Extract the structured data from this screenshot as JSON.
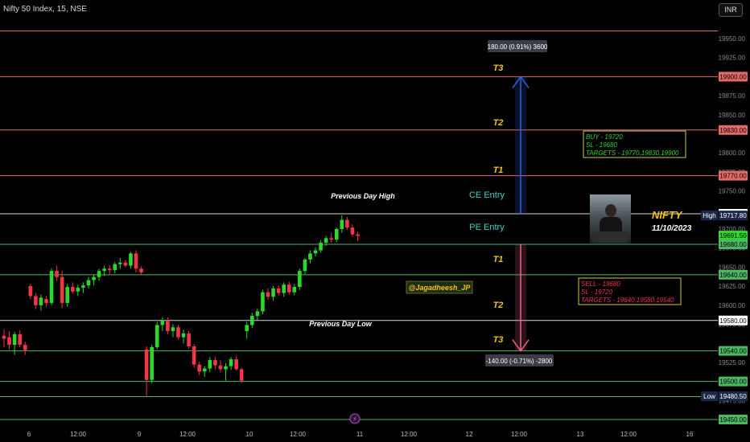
{
  "symbol": "Nifty 50 Index, 15, NSE",
  "currency": "INR",
  "colors": {
    "up": "#089981",
    "up_bright": "#2bd82b",
    "down": "#f23645",
    "red_line": "#e46a6a",
    "green_line": "#4cb863",
    "white_line": "#d8d8d8",
    "gold": "#f0c419",
    "teal": "#3fd1c7",
    "blue_arrow": "#2f5fd8",
    "pink_arrow": "#f0638c"
  },
  "price_scale": {
    "ticks": [
      "19950.00",
      "19925.00",
      "19875.00",
      "19850.00",
      "19800.00",
      "19775.00",
      "19750.00",
      "19700.00",
      "19675.00",
      "19650.00",
      "19625.00",
      "19600.00",
      "19575.00",
      "19525.00",
      "19500.00",
      "19475.00"
    ],
    "badges": [
      {
        "text": "19900.00",
        "color": "#e46a6a",
        "value": 19900
      },
      {
        "text": "19830.00",
        "color": "#e46a6a",
        "value": 19830
      },
      {
        "text": "19770.00",
        "color": "#e46a6a",
        "value": 19770
      },
      {
        "text": "19720.00",
        "color": "#ffffff",
        "value": 19720
      },
      {
        "text": "19717.80",
        "color": "#1b2a4a",
        "value": 19717.8,
        "tag": "High"
      },
      {
        "text": "19691.50",
        "color": "#2bd82b",
        "value": 19691.5
      },
      {
        "text": "19680.00",
        "color": "#4cb863",
        "value": 19680
      },
      {
        "text": "19640.00",
        "color": "#4cb863",
        "value": 19640
      },
      {
        "text": "19580.00",
        "color": "#ffffff",
        "value": 19580
      },
      {
        "text": "19540.00",
        "color": "#4cb863",
        "value": 19540
      },
      {
        "text": "19500.00",
        "color": "#4cb863",
        "value": 19500
      },
      {
        "text": "19480.50",
        "color": "#1b2a4a",
        "value": 19480.5,
        "tag": "Low"
      },
      {
        "text": "19450.00",
        "color": "#4cb863",
        "value": 19450
      }
    ]
  },
  "time_axis": [
    "6",
    "12:00",
    "9",
    "12:00",
    "10",
    "12:00",
    "11",
    "12:00",
    "12",
    "12:00",
    "13",
    "12:00",
    "16"
  ],
  "levels": [
    {
      "value": 19960,
      "color": "#e46a6a"
    },
    {
      "value": 19900,
      "color": "#e46a6a"
    },
    {
      "value": 19830,
      "color": "#e46a6a"
    },
    {
      "value": 19770,
      "color": "#e46a6a"
    },
    {
      "value": 19720,
      "color": "#d8d8d8"
    },
    {
      "value": 19680,
      "color": "#4cb863"
    },
    {
      "value": 19640,
      "color": "#4cb863"
    },
    {
      "value": 19580,
      "color": "#d8d8d8"
    },
    {
      "value": 19540,
      "color": "#4cb863"
    },
    {
      "value": 19500,
      "color": "#4cb863"
    },
    {
      "value": 19480,
      "color": "#4cb863"
    },
    {
      "value": 19450,
      "color": "#4cb863"
    }
  ],
  "labels": {
    "prev_day_high": "Previous Day High",
    "prev_day_low": "Previous Day Low",
    "ce_entry": "CE Entry",
    "pe_entry": "PE Entry",
    "t3_up": "T3",
    "t2_up": "T2",
    "t1_up": "T1",
    "t1_dn": "T1",
    "t2_dn": "T2",
    "t3_dn": "T3",
    "handle": "@Jagadheesh_JP",
    "nifty": "NIFTY",
    "date": "11/10/2023"
  },
  "measure_up": "180.00 (0.91%) 3600",
  "measure_down": "-140.00 (-0.71%) -2800",
  "buy_box": [
    "BUY - 19720",
    "SL - 19680",
    "TARGETS - 19770,19830,19900"
  ],
  "sell_box": [
    "SELL - 19680",
    "SL - 19720",
    "TARGETS - 19640,19580,19540"
  ],
  "chart_data": {
    "type": "candlestick",
    "ylim": [
      19445,
      19975
    ],
    "candles": [
      {
        "o": 19560,
        "h": 19568,
        "l": 19545,
        "c": 19556
      },
      {
        "o": 19558,
        "h": 19566,
        "l": 19542,
        "c": 19548
      },
      {
        "o": 19548,
        "h": 19565,
        "l": 19535,
        "c": 19562
      },
      {
        "o": 19562,
        "h": 19567,
        "l": 19545,
        "c": 19548
      },
      {
        "o": 19548,
        "h": 19552,
        "l": 19535,
        "c": 19541
      },
      {
        "o": 19625,
        "h": 19628,
        "l": 19608,
        "c": 19612
      },
      {
        "o": 19612,
        "h": 19616,
        "l": 19595,
        "c": 19600
      },
      {
        "o": 19600,
        "h": 19614,
        "l": 19593,
        "c": 19610
      },
      {
        "o": 19608,
        "h": 19612,
        "l": 19598,
        "c": 19603
      },
      {
        "o": 19603,
        "h": 19648,
        "l": 19600,
        "c": 19645
      },
      {
        "o": 19645,
        "h": 19652,
        "l": 19632,
        "c": 19637
      },
      {
        "o": 19637,
        "h": 19645,
        "l": 19596,
        "c": 19603
      },
      {
        "o": 19603,
        "h": 19628,
        "l": 19598,
        "c": 19624
      },
      {
        "o": 19624,
        "h": 19630,
        "l": 19615,
        "c": 19618
      },
      {
        "o": 19618,
        "h": 19627,
        "l": 19612,
        "c": 19623
      },
      {
        "o": 19623,
        "h": 19630,
        "l": 19616,
        "c": 19626
      },
      {
        "o": 19626,
        "h": 19637,
        "l": 19622,
        "c": 19633
      },
      {
        "o": 19633,
        "h": 19640,
        "l": 19626,
        "c": 19637
      },
      {
        "o": 19637,
        "h": 19648,
        "l": 19632,
        "c": 19645
      },
      {
        "o": 19645,
        "h": 19652,
        "l": 19638,
        "c": 19648
      },
      {
        "o": 19648,
        "h": 19653,
        "l": 19641,
        "c": 19646
      },
      {
        "o": 19646,
        "h": 19657,
        "l": 19642,
        "c": 19654
      },
      {
        "o": 19654,
        "h": 19662,
        "l": 19648,
        "c": 19656
      },
      {
        "o": 19656,
        "h": 19659,
        "l": 19650,
        "c": 19652
      },
      {
        "o": 19652,
        "h": 19670,
        "l": 19648,
        "c": 19668
      },
      {
        "o": 19668,
        "h": 19672,
        "l": 19643,
        "c": 19648
      },
      {
        "o": 19648,
        "h": 19651,
        "l": 19640,
        "c": 19643
      },
      {
        "o": 19542,
        "h": 19546,
        "l": 19481,
        "c": 19502
      },
      {
        "o": 19502,
        "h": 19548,
        "l": 19498,
        "c": 19545
      },
      {
        "o": 19545,
        "h": 19578,
        "l": 19542,
        "c": 19574
      },
      {
        "o": 19574,
        "h": 19584,
        "l": 19566,
        "c": 19580
      },
      {
        "o": 19580,
        "h": 19584,
        "l": 19562,
        "c": 19566
      },
      {
        "o": 19566,
        "h": 19575,
        "l": 19558,
        "c": 19571
      },
      {
        "o": 19571,
        "h": 19574,
        "l": 19555,
        "c": 19558
      },
      {
        "o": 19558,
        "h": 19568,
        "l": 19550,
        "c": 19563
      },
      {
        "o": 19563,
        "h": 19566,
        "l": 19543,
        "c": 19546
      },
      {
        "o": 19546,
        "h": 19549,
        "l": 19518,
        "c": 19522
      },
      {
        "o": 19522,
        "h": 19526,
        "l": 19508,
        "c": 19513
      },
      {
        "o": 19513,
        "h": 19520,
        "l": 19506,
        "c": 19517
      },
      {
        "o": 19517,
        "h": 19532,
        "l": 19512,
        "c": 19528
      },
      {
        "o": 19528,
        "h": 19532,
        "l": 19516,
        "c": 19521
      },
      {
        "o": 19521,
        "h": 19528,
        "l": 19512,
        "c": 19516
      },
      {
        "o": 19516,
        "h": 19524,
        "l": 19501,
        "c": 19520
      },
      {
        "o": 19520,
        "h": 19532,
        "l": 19515,
        "c": 19529
      },
      {
        "o": 19529,
        "h": 19533,
        "l": 19514,
        "c": 19516
      },
      {
        "o": 19516,
        "h": 19518,
        "l": 19498,
        "c": 19501
      },
      {
        "o": 19566,
        "h": 19578,
        "l": 19556,
        "c": 19574
      },
      {
        "o": 19574,
        "h": 19590,
        "l": 19570,
        "c": 19586
      },
      {
        "o": 19586,
        "h": 19596,
        "l": 19580,
        "c": 19592
      },
      {
        "o": 19592,
        "h": 19620,
        "l": 19588,
        "c": 19617
      },
      {
        "o": 19617,
        "h": 19622,
        "l": 19607,
        "c": 19611
      },
      {
        "o": 19611,
        "h": 19625,
        "l": 19606,
        "c": 19622
      },
      {
        "o": 19622,
        "h": 19626,
        "l": 19612,
        "c": 19616
      },
      {
        "o": 19616,
        "h": 19630,
        "l": 19611,
        "c": 19627
      },
      {
        "o": 19627,
        "h": 19631,
        "l": 19614,
        "c": 19617
      },
      {
        "o": 19617,
        "h": 19628,
        "l": 19613,
        "c": 19624
      },
      {
        "o": 19624,
        "h": 19648,
        "l": 19620,
        "c": 19645
      },
      {
        "o": 19645,
        "h": 19662,
        "l": 19641,
        "c": 19660
      },
      {
        "o": 19660,
        "h": 19672,
        "l": 19655,
        "c": 19668
      },
      {
        "o": 19668,
        "h": 19676,
        "l": 19664,
        "c": 19672
      },
      {
        "o": 19672,
        "h": 19685,
        "l": 19669,
        "c": 19682
      },
      {
        "o": 19682,
        "h": 19691,
        "l": 19678,
        "c": 19688
      },
      {
        "o": 19688,
        "h": 19695,
        "l": 19682,
        "c": 19686
      },
      {
        "o": 19686,
        "h": 19702,
        "l": 19683,
        "c": 19700
      },
      {
        "o": 19700,
        "h": 19718,
        "l": 19695,
        "c": 19712
      },
      {
        "o": 19712,
        "h": 19716,
        "l": 19699,
        "c": 19702
      },
      {
        "o": 19702,
        "h": 19706,
        "l": 19690,
        "c": 19693
      },
      {
        "o": 19693,
        "h": 19696,
        "l": 19684,
        "c": 19691
      }
    ]
  }
}
